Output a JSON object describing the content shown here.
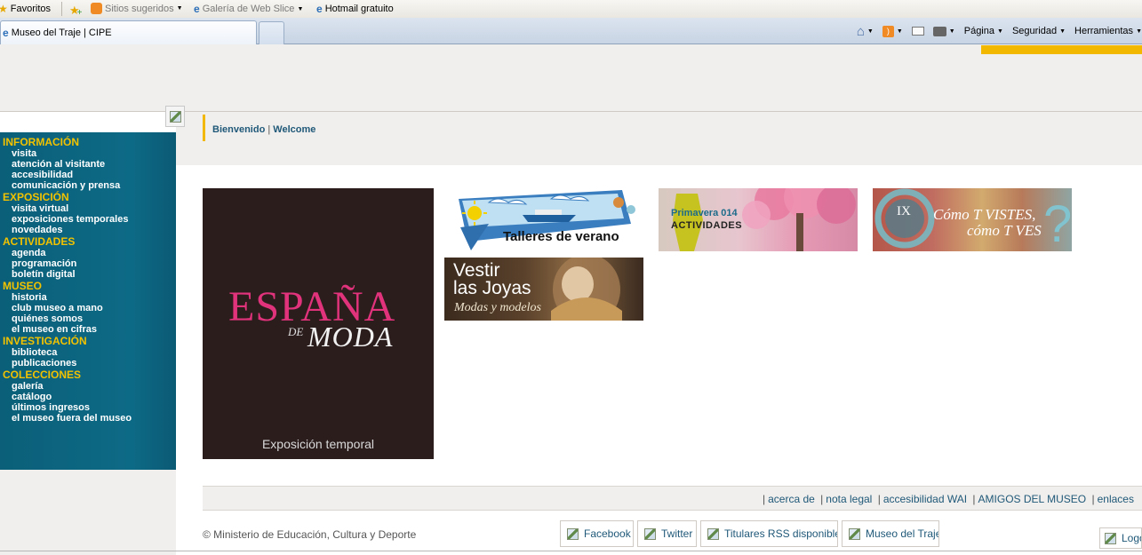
{
  "browser": {
    "favorites_bar": {
      "favorites_label": "Favoritos",
      "items": [
        {
          "label": "Sitios sugeridos"
        },
        {
          "label": "Galería de Web Slice"
        },
        {
          "label": "Hotmail gratuito"
        }
      ]
    },
    "tab": {
      "title": "Museo del Traje | CIPE"
    },
    "command_bar": {
      "page_label": "Página",
      "security_label": "Seguridad",
      "tools_label": "Herramientas"
    }
  },
  "header": {
    "welcome_es": "Bienvenido",
    "separator": "|",
    "welcome_en": "Welcome"
  },
  "sidebar": {
    "sections": [
      {
        "title": "INFORMACIÓN",
        "items": [
          "visita",
          "atención al visitante",
          "accesibilidad",
          "comunicación y prensa"
        ]
      },
      {
        "title": "EXPOSICIÓN",
        "items": [
          "visita virtual",
          "exposiciones temporales",
          "novedades"
        ]
      },
      {
        "title": "ACTIVIDADES",
        "items": [
          "agenda",
          "programación",
          "boletín digital"
        ]
      },
      {
        "title": "MUSEO",
        "items": [
          "historia",
          "club museo a mano",
          "quiénes somos",
          "el museo en cifras"
        ]
      },
      {
        "title": "INVESTIGACIÓN",
        "items": [
          "biblioteca",
          "publicaciones"
        ]
      },
      {
        "title": "COLECCIONES",
        "items": [
          "galería",
          "catálogo",
          "últimos ingresos",
          "el museo fuera del museo"
        ]
      }
    ]
  },
  "banners": {
    "espana": {
      "title_main": "ESPAÑA",
      "title_de": "DE",
      "title_moda": "MODA",
      "subtitle": "Exposición temporal"
    },
    "talleres": {
      "text": "Talleres de verano"
    },
    "vestir": {
      "line1": "Vestir",
      "line2": "las Joyas",
      "line3": "Modas y modelos"
    },
    "primavera": {
      "line1": "Primavera 014",
      "line2": "ACTIVIDADES"
    },
    "como": {
      "edition": "IX",
      "line1": "Cómo T VISTES,",
      "line2": "cómo T VES"
    }
  },
  "footer": {
    "links": [
      "acerca de",
      "nota legal",
      "accesibilidad WAI",
      "AMIGOS DEL MUSEO",
      "enlaces"
    ],
    "copyright": "© Ministerio de Educación, Cultura y Deporte",
    "social": [
      "Facebook",
      "Twitter",
      "Titulares RSS disponibles",
      "Museo del Traje"
    ],
    "partial": "Logo"
  },
  "colors": {
    "sidebar_bg": "#0d6a86",
    "section_title": "#f2c200",
    "accent_yellow": "#f2b800",
    "link_blue": "#1f5878",
    "espana_pink": "#e0337c"
  }
}
